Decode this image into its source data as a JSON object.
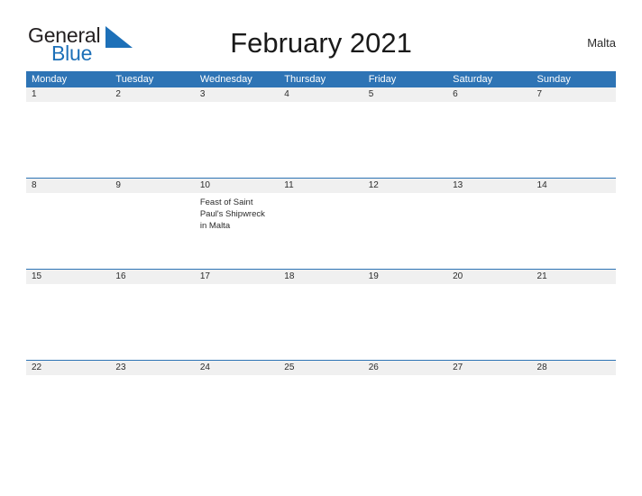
{
  "brand": {
    "name_part1": "General",
    "name_part2": "Blue",
    "mark": "triangle-logo-icon",
    "color_dark": "#231f20",
    "color_blue": "#1d70b8"
  },
  "header": {
    "title": "February 2021",
    "country": "Malta"
  },
  "theme": {
    "header_blue": "#2e74b5",
    "row_gray": "#f0f0f0",
    "text_dark": "#2b2b2b"
  },
  "calendar": {
    "weekday_headers": [
      "Monday",
      "Tuesday",
      "Wednesday",
      "Thursday",
      "Friday",
      "Saturday",
      "Sunday"
    ],
    "weeks": [
      {
        "days": [
          {
            "date": "1",
            "event": ""
          },
          {
            "date": "2",
            "event": ""
          },
          {
            "date": "3",
            "event": ""
          },
          {
            "date": "4",
            "event": ""
          },
          {
            "date": "5",
            "event": ""
          },
          {
            "date": "6",
            "event": ""
          },
          {
            "date": "7",
            "event": ""
          }
        ]
      },
      {
        "days": [
          {
            "date": "8",
            "event": ""
          },
          {
            "date": "9",
            "event": ""
          },
          {
            "date": "10",
            "event": "Feast of Saint Paul's Shipwreck in Malta"
          },
          {
            "date": "11",
            "event": ""
          },
          {
            "date": "12",
            "event": ""
          },
          {
            "date": "13",
            "event": ""
          },
          {
            "date": "14",
            "event": ""
          }
        ]
      },
      {
        "days": [
          {
            "date": "15",
            "event": ""
          },
          {
            "date": "16",
            "event": ""
          },
          {
            "date": "17",
            "event": ""
          },
          {
            "date": "18",
            "event": ""
          },
          {
            "date": "19",
            "event": ""
          },
          {
            "date": "20",
            "event": ""
          },
          {
            "date": "21",
            "event": ""
          }
        ]
      },
      {
        "days": [
          {
            "date": "22",
            "event": ""
          },
          {
            "date": "23",
            "event": ""
          },
          {
            "date": "24",
            "event": ""
          },
          {
            "date": "25",
            "event": ""
          },
          {
            "date": "26",
            "event": ""
          },
          {
            "date": "27",
            "event": ""
          },
          {
            "date": "28",
            "event": ""
          }
        ]
      }
    ]
  }
}
